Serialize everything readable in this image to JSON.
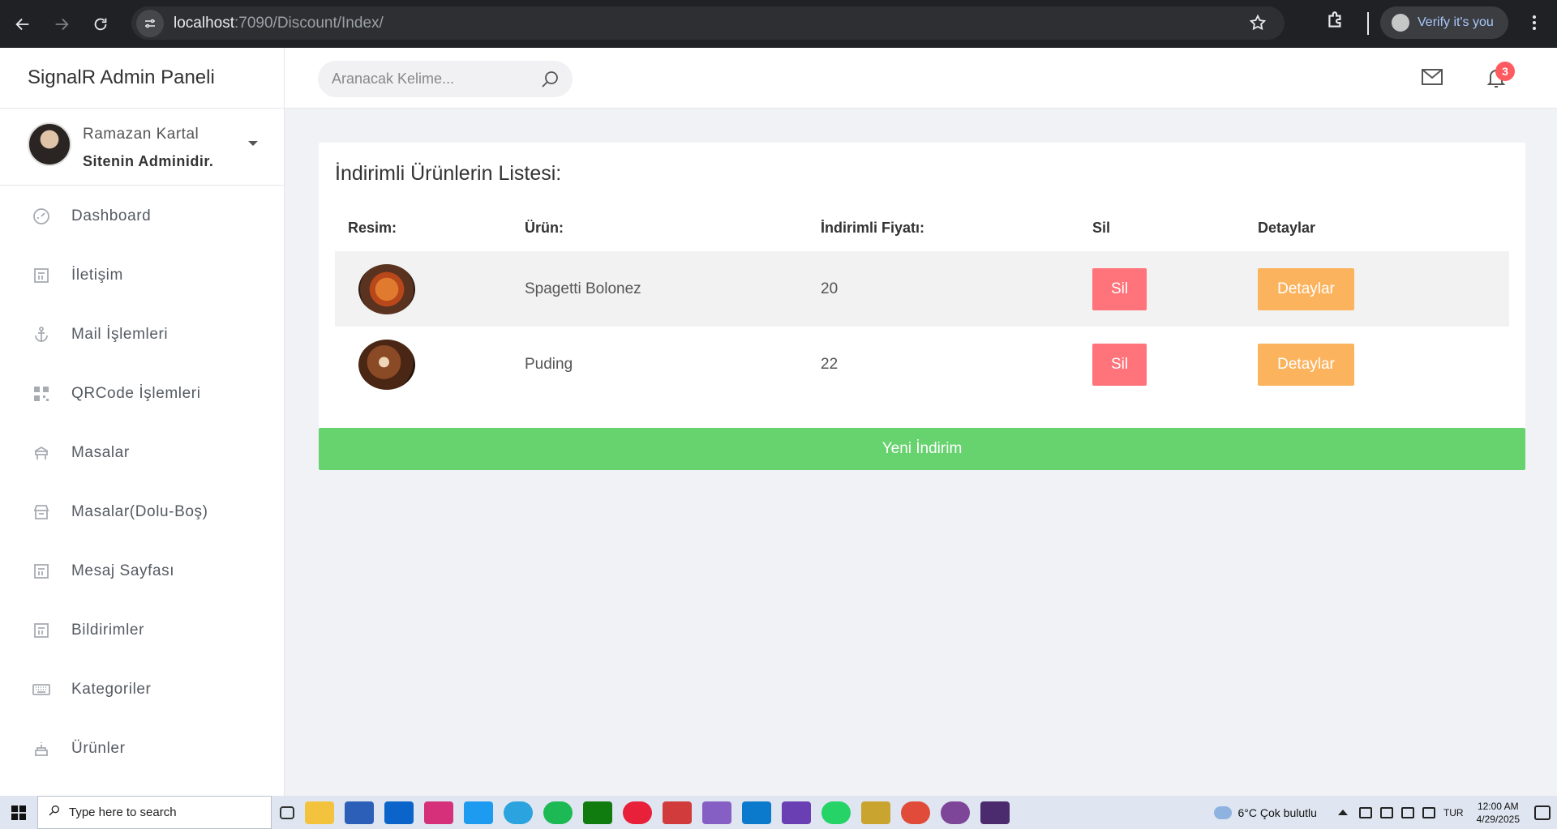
{
  "browser": {
    "url_host": "localhost",
    "url_rest": ":7090/Discount/Index/",
    "verify_label": "Verify it's you"
  },
  "sidebar": {
    "brand": "SignalR Admin Paneli",
    "user": {
      "name": "Ramazan Kartal",
      "role": "Sitenin Adminidir."
    },
    "items": [
      {
        "label": "Dashboard",
        "icon": "dashboard-icon"
      },
      {
        "label": "İletişim",
        "icon": "contact-icon"
      },
      {
        "label": "Mail İşlemleri",
        "icon": "anchor-icon"
      },
      {
        "label": "QRCode İşlemleri",
        "icon": "qrcode-icon"
      },
      {
        "label": "Masalar",
        "icon": "table-icon"
      },
      {
        "label": "Masalar(Dolu-Boş)",
        "icon": "table-status-icon"
      },
      {
        "label": "Mesaj Sayfası",
        "icon": "message-icon"
      },
      {
        "label": "Bildirimler",
        "icon": "notification-icon"
      },
      {
        "label": "Kategoriler",
        "icon": "keyboard-icon"
      },
      {
        "label": "Ürünler",
        "icon": "cake-icon"
      }
    ]
  },
  "topbar": {
    "search_placeholder": "Aranacak Kelime...",
    "notification_count": "3"
  },
  "main": {
    "title": "İndirimli Ürünlerin Listesi:",
    "columns": [
      "Resim:",
      "Ürün:",
      "İndirimli Fiyatı:",
      "Sil",
      "Detaylar"
    ],
    "rows": [
      {
        "product": "Spagetti Bolonez",
        "price": "20",
        "delete_label": "Sil",
        "details_label": "Detaylar"
      },
      {
        "product": "Puding",
        "price": "22",
        "delete_label": "Sil",
        "details_label": "Detaylar"
      }
    ],
    "new_button": "Yeni İndirim"
  },
  "taskbar": {
    "search_placeholder": "Type here to search",
    "weather": "6°C  Çok bulutlu",
    "language": "TUR",
    "time": "12:00 AM",
    "date": "4/29/2025"
  }
}
